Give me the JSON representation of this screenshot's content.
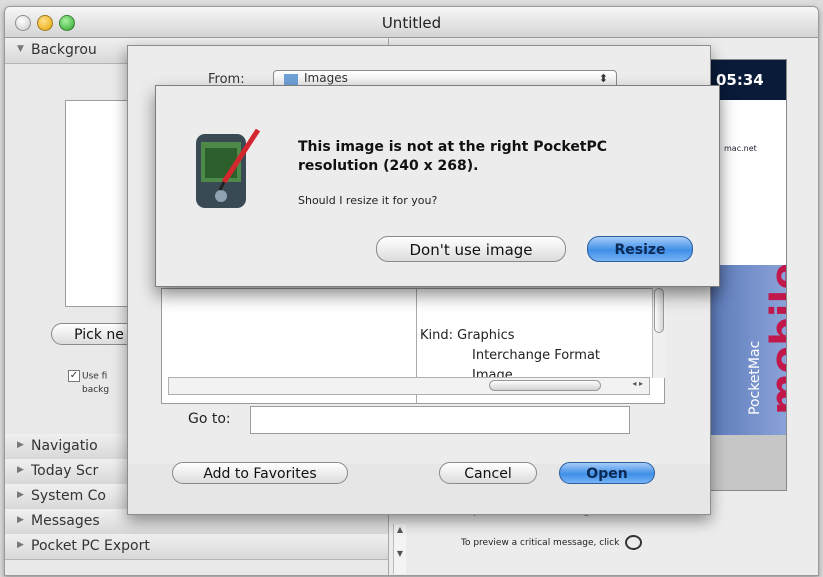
{
  "window": {
    "title": "Untitled"
  },
  "left_panel": {
    "sections_top": [
      {
        "label": "Backgrou"
      }
    ],
    "pick_button": "Pick ne",
    "checkbox_text": "Use fi",
    "checkbox_text2": "backg",
    "checkbox_checked": "✓",
    "sections_bottom": [
      {
        "label": "Navigatio"
      },
      {
        "label": "Today Scr"
      },
      {
        "label": "System Co"
      },
      {
        "label": "Messages"
      },
      {
        "label": "Pocket PC Export"
      }
    ]
  },
  "preview": {
    "clock": "05:34",
    "url_text": "mac.net",
    "brand_small": "PocketMac",
    "brand_big": "mobile",
    "preview_msg_1": "To preview a normal message, click the clock",
    "preview_msg_2": "To preview a critical message, click"
  },
  "open_sheet": {
    "from_label": "From:",
    "from_value": "Images",
    "kind_label": "Kind:",
    "kind_value_lines": [
      "Graphics",
      "Interchange Format",
      "Image"
    ],
    "goto_label": "Go to:",
    "goto_value": "",
    "add_favorites": "Add to Favorites",
    "cancel": "Cancel",
    "open": "Open"
  },
  "alert": {
    "heading": "This image is not at the right PocketPC resolution (240 x 268).",
    "subtext": "Should I resize it for you?",
    "dont_use": "Don't use image",
    "resize": "Resize"
  }
}
